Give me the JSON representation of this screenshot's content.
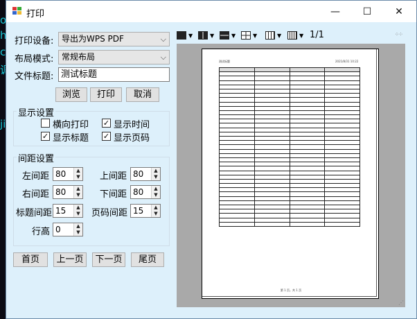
{
  "window": {
    "title": "打印"
  },
  "controls": {
    "minimize": "—",
    "maximize": "☐",
    "close": "✕"
  },
  "settings": {
    "device_label": "打印设备:",
    "device_value": "导出为WPS PDF",
    "layout_label": "布局模式:",
    "layout_value": "常规布局",
    "doc_title_label": "文件标题:",
    "doc_title_value": "测试标题"
  },
  "buttons": {
    "browse": "浏览",
    "print": "打印",
    "cancel": "取消"
  },
  "display": {
    "group_label": "显示设置",
    "landscape": {
      "label": "横向打印",
      "checked": false
    },
    "show_time": {
      "label": "显示时间",
      "checked": true
    },
    "show_title": {
      "label": "显示标题",
      "checked": true
    },
    "show_page": {
      "label": "显示页码",
      "checked": true
    }
  },
  "spacing": {
    "group_label": "间距设置",
    "left": {
      "label": "左间距",
      "value": "80"
    },
    "top": {
      "label": "上间距",
      "value": "80"
    },
    "right": {
      "label": "右间距",
      "value": "80"
    },
    "bottom": {
      "label": "下间距",
      "value": "80"
    },
    "title_gap": {
      "label": "标题间距",
      "value": "15"
    },
    "page_gap": {
      "label": "页码间距",
      "value": "15"
    },
    "row_height": {
      "label": "行高",
      "value": "0"
    }
  },
  "nav": {
    "first": "首页",
    "prev": "上一页",
    "next": "下一页",
    "last": "尾页"
  },
  "toolbar": {
    "page_count": "1/1"
  },
  "preview": {
    "title": "测试标题",
    "time": "2021/8/31 10:22",
    "footer": "第 1 页，共 1 页"
  },
  "colors": {
    "window_bg": "#ddf0fb",
    "preview_bg": "#a9a9a9"
  },
  "background": {
    "glyphs": [
      "o",
      "h",
      "c",
      "调",
      "",
      "",
      "",
      "",
      "",
      "ji"
    ]
  }
}
